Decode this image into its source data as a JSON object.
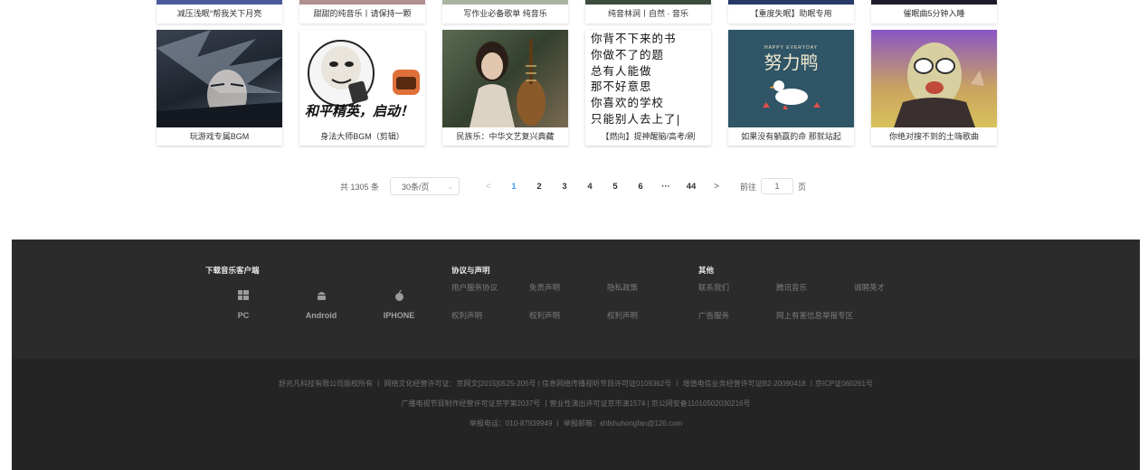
{
  "top_row": [
    {
      "title": "减压浅眠°帮我关下月亮",
      "color": "#4a5a9a"
    },
    {
      "title": "甜甜的纯音乐丨请保持一颗",
      "color": "#b09090"
    },
    {
      "title": "写作业必备歌单 纯音乐",
      "color": "#a9b4a1"
    },
    {
      "title": "纯音林涧丨自然 · 音乐",
      "color": "#3b4c3c"
    },
    {
      "title": "【重度失眠】助眠专用",
      "color": "#263a6a"
    },
    {
      "title": "催眠曲5分钟入睡",
      "color": "#1c1c2a"
    }
  ],
  "playlists": [
    {
      "title": "玩游戏专属BGM",
      "cover": "anime"
    },
    {
      "title": "身法大师BGM（剪辑）",
      "cover": "meme",
      "cover_text": "和平精英，启动！"
    },
    {
      "title": "民族乐：中华文艺复兴典藏",
      "cover": "pipa"
    },
    {
      "title": "【燃向】提神醒脑/高考/刷",
      "cover": "poem",
      "poem_lines": [
        "你背不下来的书",
        "你做不了的题",
        "总有人能做",
        "那不好意思",
        "你喜欢的学校",
        "只能别人去上了|"
      ]
    },
    {
      "title": "如果没有躺赢的命 那就站起",
      "cover": "duck",
      "cover_small": "HAPPY EVERYDAY",
      "cover_text": "努力鸭"
    },
    {
      "title": "你绝对搜不到的土嗨歌曲",
      "cover": "mask"
    }
  ],
  "pagination": {
    "total": "共 1305 条",
    "page_size": "30条/页",
    "prev": "<",
    "pages": [
      "1",
      "2",
      "3",
      "4",
      "5",
      "6",
      "···",
      "44"
    ],
    "current": "1",
    "next": ">",
    "goto_label": "前往",
    "goto_value": "1",
    "goto_suffix": "页"
  },
  "footer": {
    "download_title": "下载音乐客户端",
    "downloads": [
      {
        "label": "PC",
        "icon": "windows-icon"
      },
      {
        "label": "Android",
        "icon": "android-icon"
      },
      {
        "label": "IPHONE",
        "icon": "apple-icon"
      }
    ],
    "legal_title": "协议与声明",
    "legal_links": [
      "用户服务协议",
      "免责声明",
      "隐私政策",
      "权利声明",
      "权利声明",
      "权利声明"
    ],
    "other_title": "其他",
    "other_links": [
      "联系我们",
      "腾讯音乐",
      "诚聘英才",
      "广告服务",
      "网上有害信息举报专区"
    ],
    "license_lines": [
      "舒兆凡科技有限公司版权所有  丨  网络文化经营许可证：京网文[2015]0525-205号 | 信息网络传播视听节目许可证0109362号  丨  增值电信业务经营许可证B2-20090418  丨京ICP证060261号",
      "广播电视节目制作经营许可证京字第2037号  丨营业性演出许可证京市演1574 | 京公网安备11010502030216号",
      "举报电话：010-87939949 丨 举报邮箱：shfshuhongfan@126.com"
    ]
  }
}
